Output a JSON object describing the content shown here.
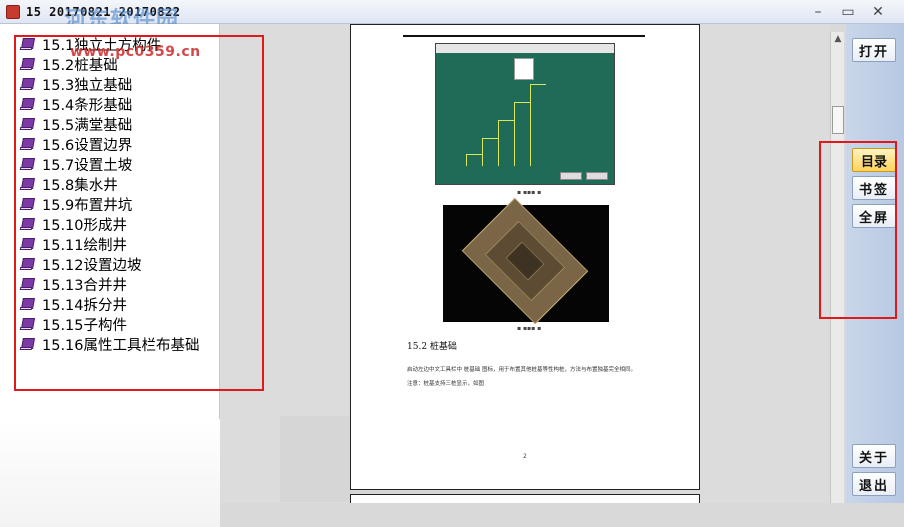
{
  "titlebar": {
    "tab_text": "15 20170821 20170822",
    "watermark_name": "河东软件园",
    "watermark_url": "www.pc0359.cn",
    "minimize": "–",
    "maximize": "▭",
    "close": "✕"
  },
  "toc": [
    {
      "label": "15.1独立土方构件"
    },
    {
      "label": "15.2桩基础"
    },
    {
      "label": "15.3独立基础"
    },
    {
      "label": "15.4条形基础"
    },
    {
      "label": "15.5满堂基础"
    },
    {
      "label": "15.6设置边界"
    },
    {
      "label": "15.7设置土坡"
    },
    {
      "label": "15.8集水井"
    },
    {
      "label": "15.9布置井坑"
    },
    {
      "label": "15.10形成井"
    },
    {
      "label": "15.11绘制井"
    },
    {
      "label": "15.12设置边坡"
    },
    {
      "label": "15.13合并井"
    },
    {
      "label": "15.14拆分井"
    },
    {
      "label": "15.15子构件"
    },
    {
      "label": "15.16属性工具栏布基础"
    }
  ],
  "document": {
    "heading": "15.2 桩基础",
    "line1": "启动左边中文工具栏中 桩基础 图标，用于布置其他桩基等性构桩，方法与布置独基完全相同。",
    "line2": "注意：桩基支持三桩显示，如图",
    "page_number": "2"
  },
  "right_buttons": {
    "open": "打开",
    "toc": "目录",
    "bookmark": "书签",
    "fullscreen": "全屏",
    "about": "关于",
    "exit": "退出"
  },
  "icons": {
    "app": "app-icon",
    "toc_item": "book-icon",
    "scroll_up": "triangle-up-icon"
  },
  "colors": {
    "highlight_box": "#e01a1a",
    "active_button": "#ffd35c"
  }
}
